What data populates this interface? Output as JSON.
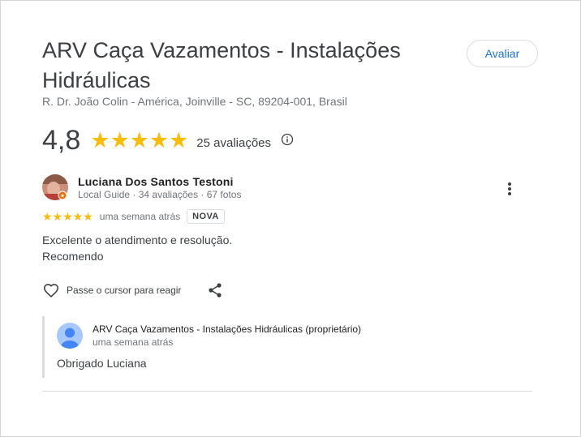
{
  "place": {
    "title": "ARV Caça Vazamentos - Instalações Hidráulicas",
    "address": "R. Dr. João Colin - América, Joinville - SC, 89204-001, Brasil",
    "rate_button": "Avaliar",
    "rating": "4,8",
    "stars": "★★★★★",
    "review_count": "25 avaliações",
    "info_icon": "info-icon"
  },
  "review": {
    "author": "Luciana Dos Santos Testoni",
    "meta": "Local Guide · 34 avaliações · 67 fotos",
    "stars": "★★★★★",
    "time": "uma semana atrás",
    "badge": "NOVA",
    "text_line1": "Excelente o atendimento e resolução.",
    "text_line2": "Recomendo",
    "react_hint": "Passe o cursor para reagir",
    "icons": [
      "heart-icon",
      "share-icon",
      "more-vert-icon",
      "local-guide-badge-icon"
    ]
  },
  "owner_reply": {
    "name": "ARV Caça Vazamentos - Instalações Hidráulicas (proprietário)",
    "time": "uma semana atrás",
    "text": "Obrigado Luciana",
    "icon": "default-avatar-icon"
  },
  "colors": {
    "star": "#fbbc04",
    "link_blue": "#1a73e8",
    "secondary_text": "#70757a",
    "divider": "#dadce0"
  }
}
